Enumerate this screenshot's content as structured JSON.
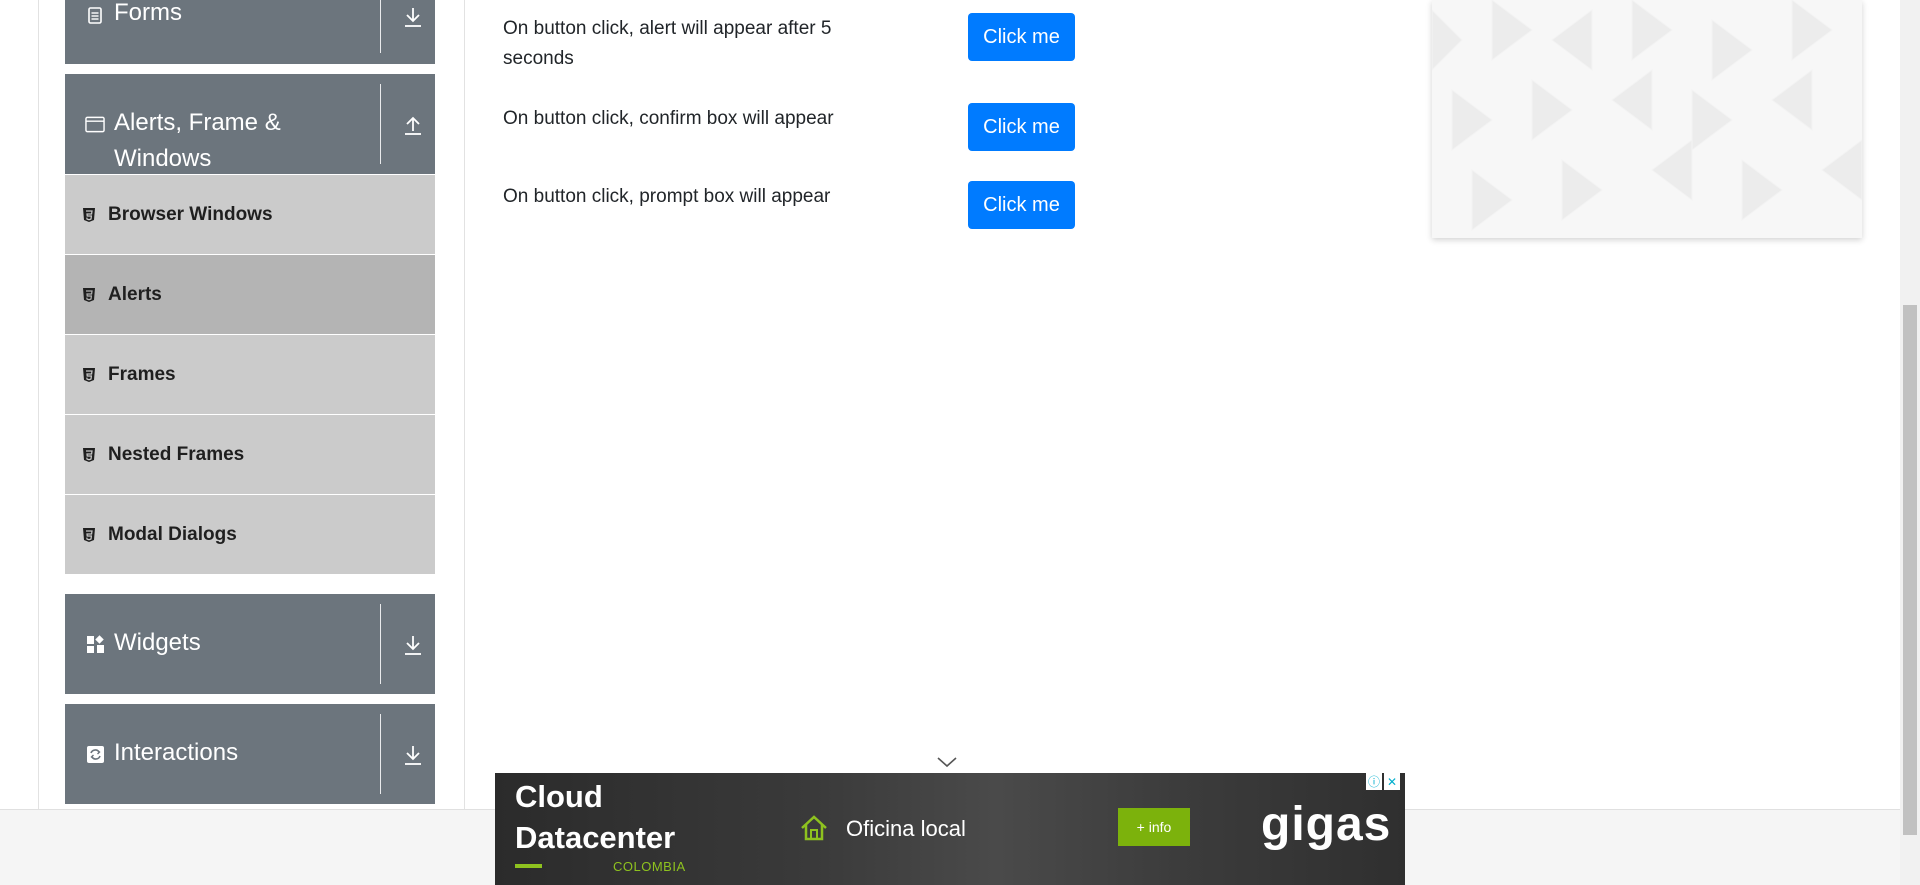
{
  "sidebar": {
    "groups": [
      {
        "title": "Forms",
        "icon": "document-icon",
        "toggle": "download-arrow-icon"
      },
      {
        "title": "Alerts, Frame & Windows",
        "icon": "window-icon",
        "toggle": "upload-arrow-icon"
      },
      {
        "title": "Widgets",
        "icon": "widgets-icon",
        "toggle": "download-arrow-icon"
      },
      {
        "title": "Interactions",
        "icon": "interactions-icon",
        "toggle": "download-arrow-icon"
      }
    ],
    "items": [
      {
        "label": "Browser Windows",
        "icon": "html5-icon",
        "active": false
      },
      {
        "label": "Alerts",
        "icon": "html5-icon",
        "active": true
      },
      {
        "label": "Frames",
        "icon": "html5-icon",
        "active": false
      },
      {
        "label": "Nested Frames",
        "icon": "html5-icon",
        "active": false
      },
      {
        "label": "Modal Dialogs",
        "icon": "html5-icon",
        "active": false
      }
    ]
  },
  "content": {
    "rows": [
      {
        "text": "On button click, alert will appear after 5 seconds",
        "button": "Click me"
      },
      {
        "text": "On button click, confirm box will appear",
        "button": "Click me"
      },
      {
        "text": "On button click, prompt box will appear",
        "button": "Click me"
      }
    ]
  },
  "ad": {
    "headline": "Cloud Datacenter",
    "subline": "COLOMBIA",
    "office": "Oficina local",
    "info_button": "+ info",
    "brand": "gigas",
    "info_icon": "ⓘ",
    "close_icon": "✕"
  },
  "colors": {
    "sidebar_header": "#6c757d",
    "menu_item": "#cbcbcb",
    "menu_item_active": "#b4b4b4",
    "primary_button": "#007bff",
    "ad_accent": "#8ec21f"
  }
}
